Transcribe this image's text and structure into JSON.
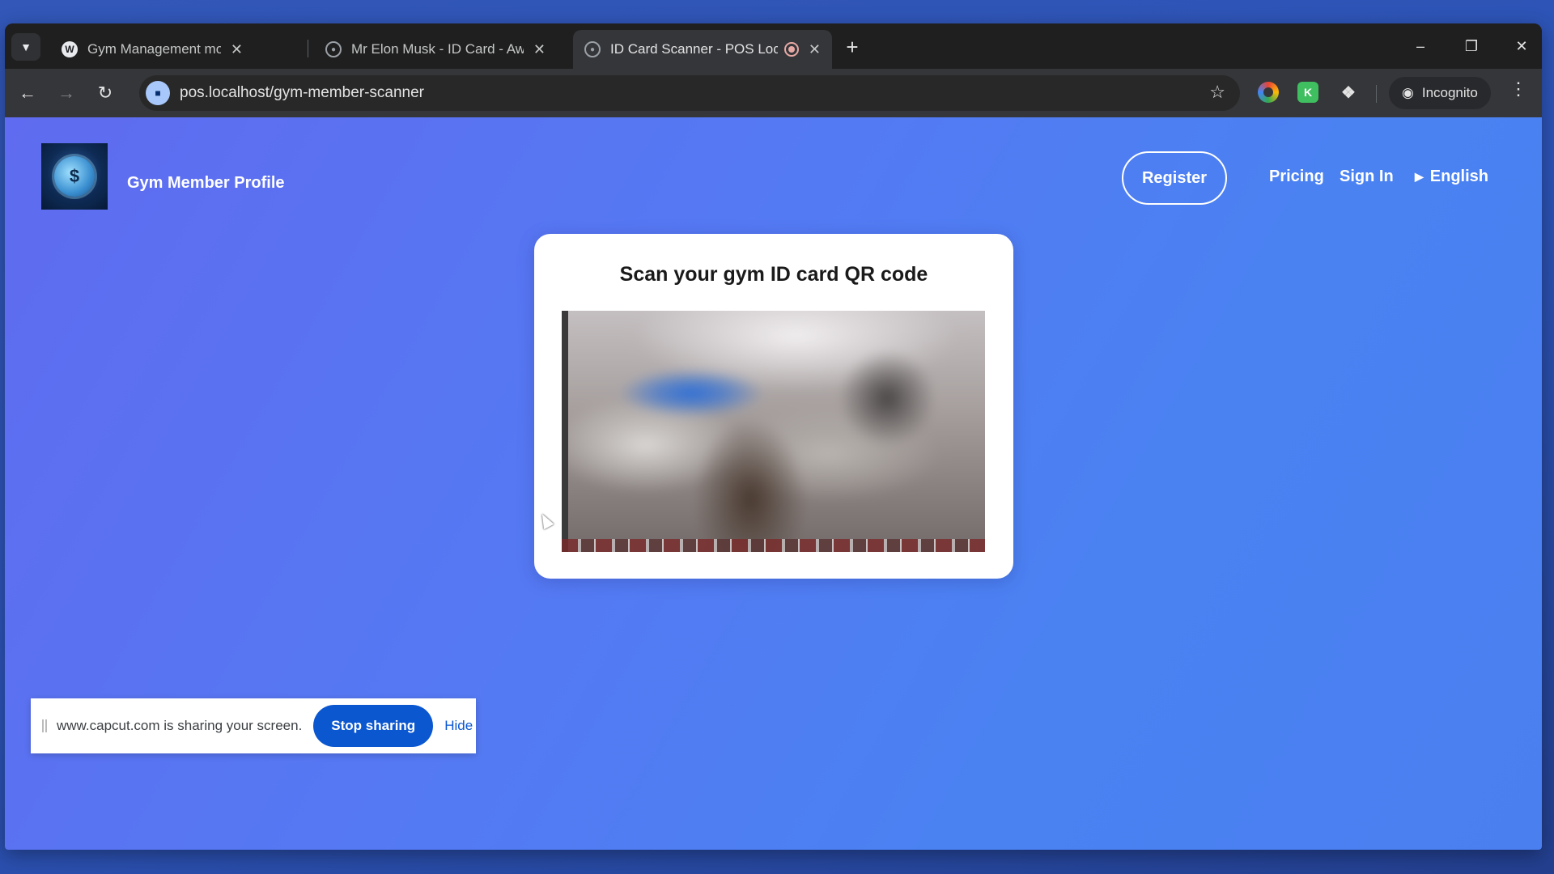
{
  "browser": {
    "tab_search_icon": "chevron-down-icon",
    "tabs": [
      {
        "title": "Gym Management module for …",
        "favicon": "wordpress-icon",
        "close": "✕"
      },
      {
        "title": "Mr Elon Musk - ID Card - Awes…",
        "favicon": "globe-icon",
        "close": "✕"
      },
      {
        "title": "ID Card Scanner - POS Loca…",
        "favicon": "globe-icon",
        "close": "✕",
        "recording": true
      }
    ],
    "new_tab": "+",
    "window_controls": {
      "minimize": "–",
      "restore": "❐",
      "close": "✕"
    },
    "nav": {
      "back": "←",
      "forward": "→",
      "reload": "↻"
    },
    "address": "pos.localhost/gym-member-scanner",
    "bookmark": "☆",
    "incognito_label": "Incognito",
    "menu": "⋮"
  },
  "site": {
    "brand": "Gym Member Profile",
    "nav": {
      "register": "Register",
      "pricing": "Pricing",
      "sign_in": "Sign In",
      "language": "English"
    }
  },
  "scanner": {
    "title": "Scan your gym ID card QR code"
  },
  "screen_share": {
    "message": "www.capcut.com is sharing your screen.",
    "stop": "Stop sharing",
    "hide": "Hide"
  },
  "colors": {
    "page_gradient_start": "#5f6bf0",
    "page_gradient_end": "#4a7ff0",
    "stop_button": "#0b57d0"
  }
}
